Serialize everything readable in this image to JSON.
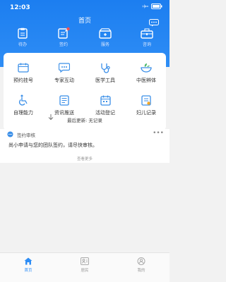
{
  "status": {
    "time": "12:03"
  },
  "header": {
    "title": "首页"
  },
  "top_actions": [
    {
      "label": "待办",
      "icon": "clipboard-icon"
    },
    {
      "label": "签约",
      "icon": "sign-pen-icon"
    },
    {
      "label": "服务",
      "icon": "service-box-icon"
    },
    {
      "label": "咨询",
      "icon": "consult-briefcase-icon"
    }
  ],
  "grid": [
    {
      "label": "预约挂号",
      "icon": "appointment-icon"
    },
    {
      "label": "专家互动",
      "icon": "chat-bubble-icon"
    },
    {
      "label": "医学工具",
      "icon": "stethoscope-icon"
    },
    {
      "label": "中医辨体",
      "icon": "herb-bowl-icon"
    },
    {
      "label": "自理能力",
      "icon": "wheelchair-icon"
    },
    {
      "label": "资讯推送",
      "icon": "news-icon"
    },
    {
      "label": "活动登记",
      "icon": "calendar-icon"
    },
    {
      "label": "妇儿记录",
      "icon": "record-icon"
    }
  ],
  "update": {
    "label": "最后更新:",
    "value": "无记录"
  },
  "notice": {
    "title": "签约审核",
    "text": "尚小申请与您的团队签约，请尽快审核。",
    "more": "•••",
    "view_more": "查看更多"
  },
  "tabbar": [
    {
      "label": "首页",
      "icon": "home-icon",
      "active": true
    },
    {
      "label": "居民",
      "icon": "residents-icon",
      "active": false
    },
    {
      "label": "我的",
      "icon": "profile-icon",
      "active": false
    }
  ],
  "colors": {
    "primary": "#2e8df5",
    "icon_blue": "#3b8fe8"
  }
}
